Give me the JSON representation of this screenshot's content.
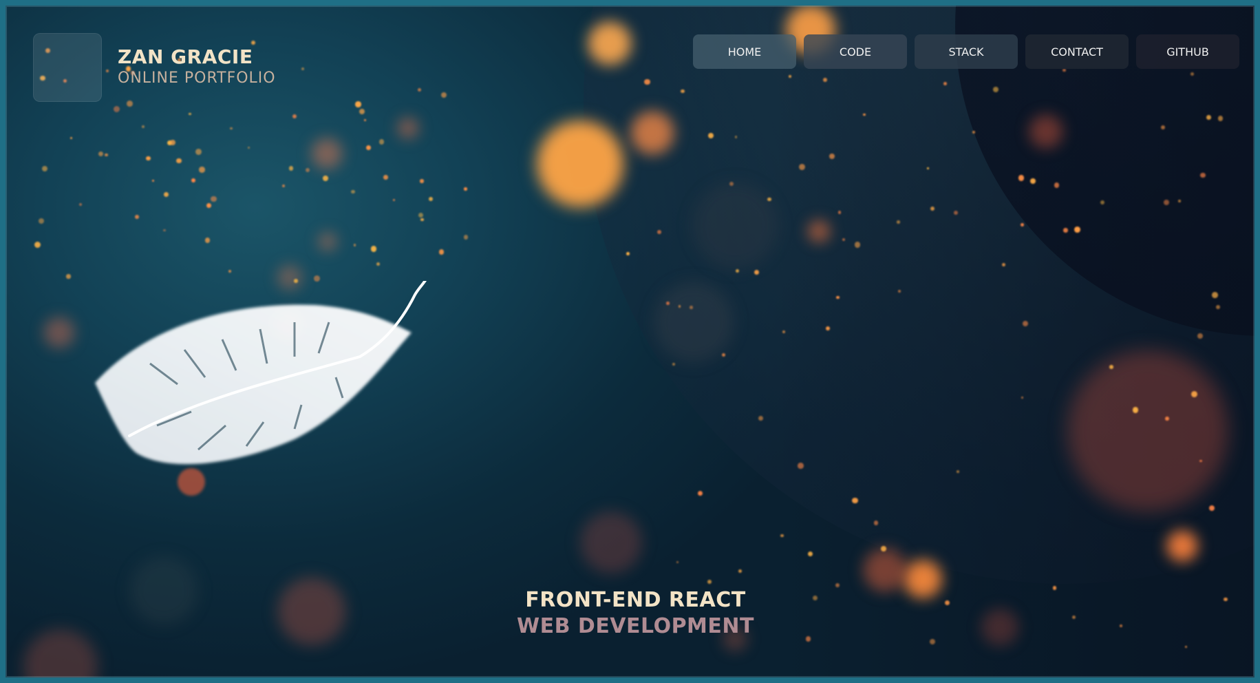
{
  "brand": {
    "name": "ZAN GRACIE",
    "subtitle": "ONLINE PORTFOLIO"
  },
  "nav": {
    "items": [
      {
        "label": "HOME"
      },
      {
        "label": "CODE"
      },
      {
        "label": "STACK"
      },
      {
        "label": "CONTACT"
      },
      {
        "label": "GITHUB"
      }
    ]
  },
  "hero": {
    "line1": "FRONT-END REACT",
    "line2": "WEB DEVELOPMENT"
  },
  "colors": {
    "accent_orange": "#ff9a3c",
    "title_cream": "#f2e3c6",
    "subtitle_mauve": "#b08c93",
    "frame_teal": "#1f6f86"
  }
}
